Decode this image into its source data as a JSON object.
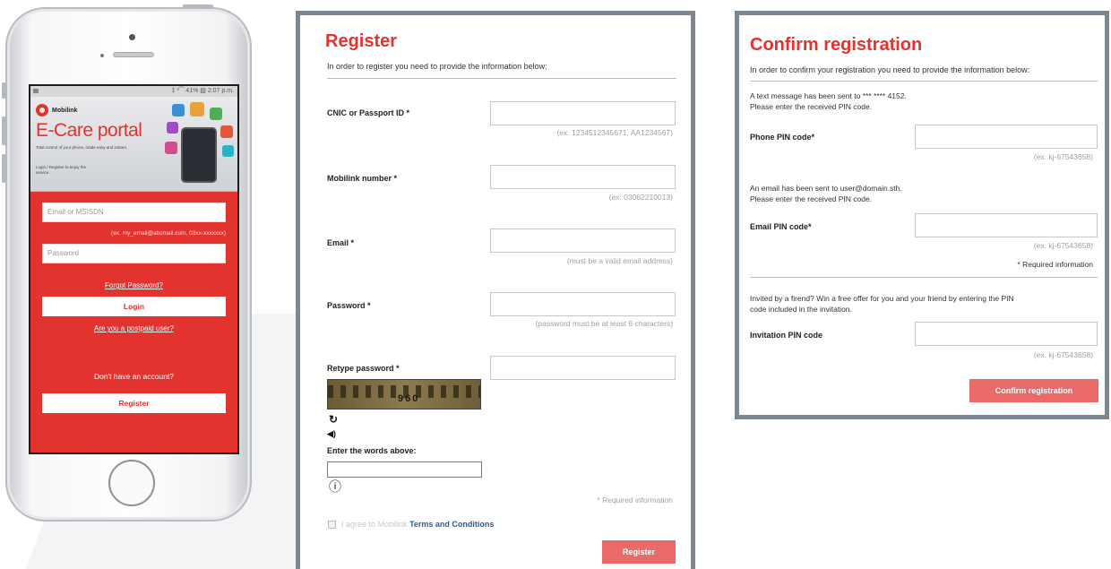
{
  "mobile": {
    "status_bar": "‡ ³⁀ 41% ▨ 2:07 p.m.",
    "brand_name": "Mobilink",
    "portal_title": "E-Care portal",
    "portal_subtitle": "Total control of your phone, made easy and instant",
    "portal_login_text": "Login / Register to enjoy the service.",
    "email_placeholder": "Email or MSISDN",
    "email_hint": "(ex. my_email@abcmail.com, 03xx-xxxxxxx)",
    "password_placeholder": "Password",
    "forgot_password": "Forgot Password?",
    "login_button": "Login",
    "postpaid_link": "Are you a postpaid user?",
    "no_account": "Don't have an account?",
    "register_button": "Register"
  },
  "register": {
    "title": "Register",
    "intro": "In order to register you need to provide the information below:",
    "fields": [
      {
        "label": "CNIC or Passport ID *",
        "hint": "(ex. 1234512345671, AA1234567)"
      },
      {
        "label": "Mobilink number *",
        "hint": "(ex: 03062210013)"
      },
      {
        "label": "Email *",
        "hint": "(must be a valid email address)"
      },
      {
        "label": "Password *",
        "hint": "(password must be at least 6 characters)"
      },
      {
        "label": "Retype password *",
        "hint": ""
      }
    ],
    "captcha_text": "960",
    "captcha_label": "Enter the words above:",
    "required_info": "* Required information",
    "agree_prefix": "I agree to Mobilink",
    "terms_link": "Terms and Conditions",
    "submit_button": "Register"
  },
  "confirm": {
    "title": "Confirm registration",
    "intro": "In order to confirm your registration you need to provide the information below:",
    "sms_line1": "A text message has been sent to *** **** 4152.",
    "sms_line2": "Please enter the received PIN code.",
    "phone_pin_label": "Phone PIN code*",
    "phone_pin_hint": "(ex. kj-67543658)",
    "email_line1": "An email has been sent to user@domain.sth.",
    "email_line2": "Please enter the received PIN code.",
    "email_pin_label": "Email PIN code*",
    "email_pin_hint": "(ex. kj-67543658)",
    "required_info": "* Required information",
    "invite_line1": "Invited by a firend? Win a free offer for you and your friend by entering the PIN",
    "invite_line2": "code included in the invitation.",
    "invite_pin_label": "Invitation PIN code",
    "invite_pin_hint": "(ex. kj-67543658)",
    "submit_button": "Confirm registration"
  },
  "icons": {
    "refresh": "↻",
    "audio": "◀)",
    "info": "ⓘ"
  },
  "colors": {
    "accent": "#e3332f",
    "button": "#ea6a6a",
    "panel_border": "#7c8791",
    "link": "#2a5f95"
  }
}
